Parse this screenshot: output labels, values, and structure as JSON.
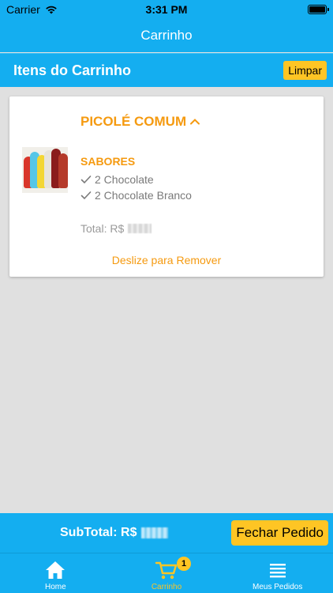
{
  "status_bar": {
    "carrier": "Carrier",
    "time": "3:31 PM"
  },
  "nav": {
    "title": "Carrinho"
  },
  "section": {
    "title": "Itens do Carrinho",
    "clear_label": "Limpar"
  },
  "cart_item": {
    "product_name": "PICOLÉ COMUM",
    "flavors_label": "SABORES",
    "flavors": [
      "2 Chocolate",
      "2 Chocolate Branco"
    ],
    "total_label": "Total: R$",
    "swipe_hint": "Deslize para Remover"
  },
  "footer": {
    "subtotal_label": "SubTotal: R$",
    "close_order_label": "Fechar Pedido"
  },
  "tabs": [
    {
      "label": "Home",
      "icon": "home-icon",
      "active": false
    },
    {
      "label": "Carrinho",
      "icon": "cart-icon",
      "active": true,
      "badge": "1"
    },
    {
      "label": "Meus Pedidos",
      "icon": "menu-icon",
      "active": false
    }
  ],
  "colors": {
    "primary": "#14aef0",
    "accent": "#fec524",
    "orange_text": "#f59a10"
  }
}
